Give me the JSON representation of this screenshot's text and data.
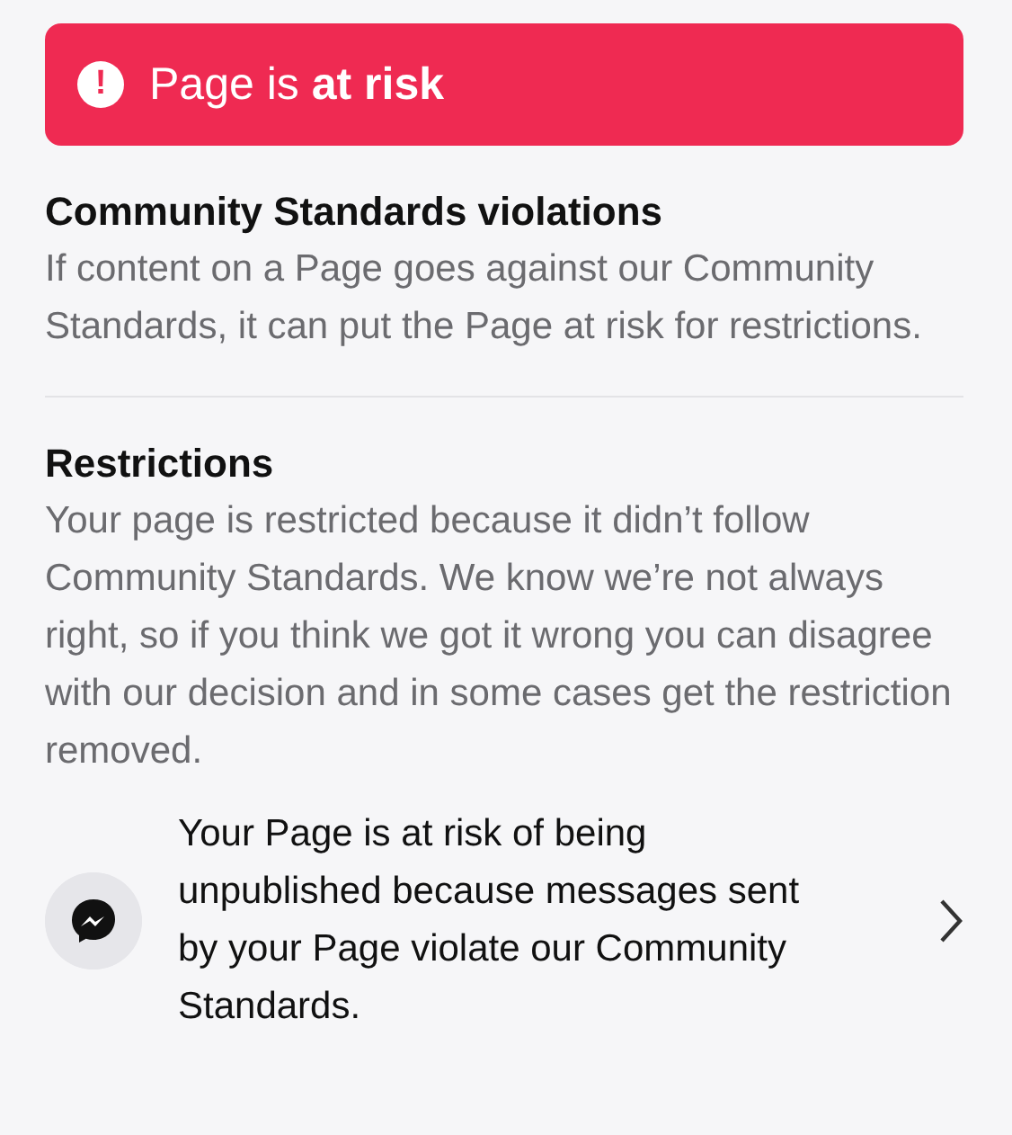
{
  "banner": {
    "icon": "!",
    "text": "Page is **at risk**"
  },
  "sections": [
    {
      "heading": "Community Standards violations",
      "body": "If content on a Page goes against our Community Standards, it can put the Page at risk for restrictions."
    },
    {
      "heading": "Restrictions",
      "body": "Your page is restricted because it didn’t follow Community Standards. We know we’re not always right, so if you think we got it wrong you can disagree with our decision and in some cases get the restriction removed."
    }
  ],
  "item": {
    "text": "Your Page is at risk of being unpublished because messages sent by your Page violate our Community Standards."
  }
}
